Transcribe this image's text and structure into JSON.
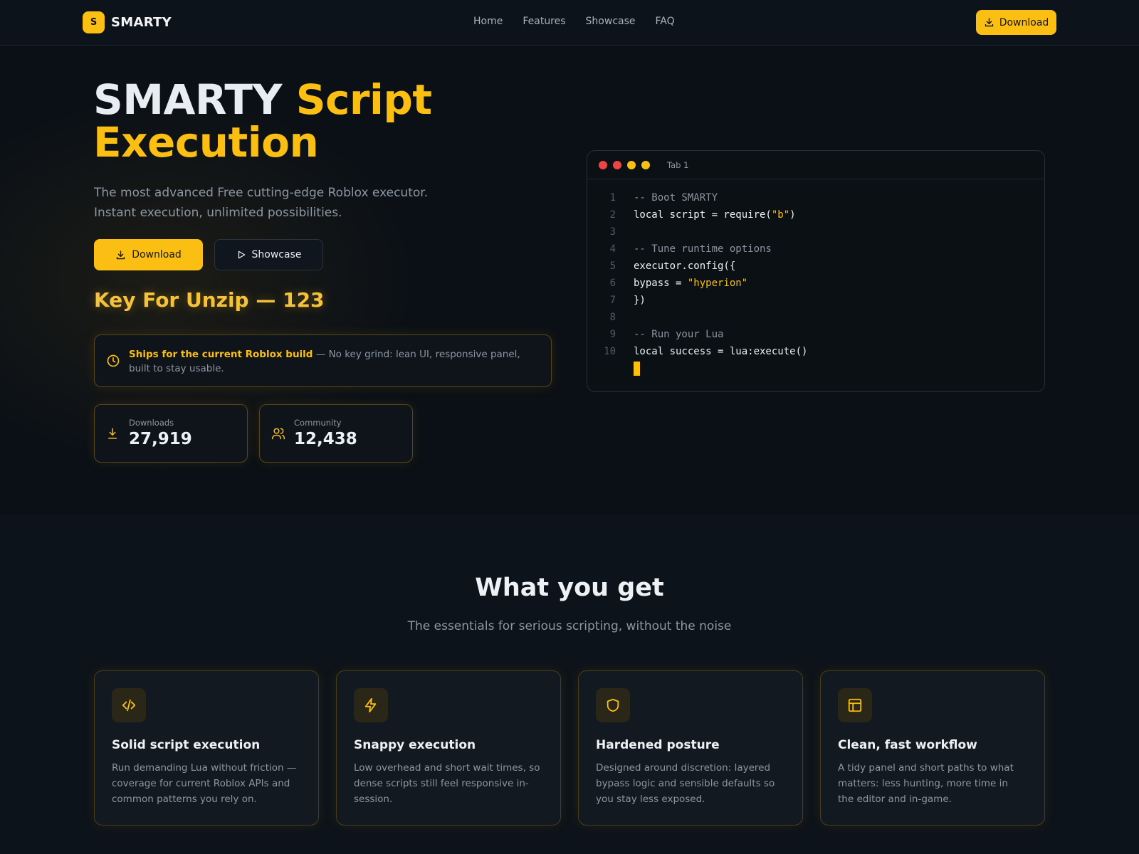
{
  "brand": {
    "logo_letter": "S",
    "name": "SMARTY"
  },
  "nav": {
    "links": [
      "Home",
      "Features",
      "Showcase",
      "FAQ"
    ],
    "download_label": "Download"
  },
  "hero": {
    "title_white": "SMARTY ",
    "title_yellow_1": "Script",
    "title_yellow_2": "Execution",
    "subtitle": "The most advanced Free cutting-edge Roblox executor. Instant execution, unlimited possibilities.",
    "download_label": "Download",
    "showcase_label": "Showcase",
    "key_text": "Key For Unzip — 123",
    "notice_bold": "Ships for the current Roblox build",
    "notice_rest": " — No key grind: lean UI, responsive panel, built to stay usable.",
    "stats": [
      {
        "label": "Downloads",
        "value": "27,919"
      },
      {
        "label": "Community",
        "value": "12,438"
      }
    ]
  },
  "code_window": {
    "tab_label": "Tab 1",
    "lines": [
      {
        "n": "1",
        "text": "-- Boot SMARTY",
        "comment": true
      },
      {
        "n": "2",
        "pre": "local script = require(",
        "str": "\"b\"",
        "post": ")"
      },
      {
        "n": "3",
        "text": ""
      },
      {
        "n": "4",
        "text": "-- Tune runtime options",
        "comment": true
      },
      {
        "n": "5",
        "text": "executor.config({"
      },
      {
        "n": "6",
        "pre": "bypass = ",
        "str": "\"hyperion\"",
        "post": ""
      },
      {
        "n": "7",
        "text": "})"
      },
      {
        "n": "8",
        "text": ""
      },
      {
        "n": "9",
        "text": "-- Run your Lua",
        "comment": true
      },
      {
        "n": "10",
        "text": "local success = lua:execute()"
      }
    ]
  },
  "features": {
    "title": "What you get",
    "subtitle": "The essentials for serious scripting, without the noise",
    "cards": [
      {
        "icon": "code-icon",
        "title": "Solid script execution",
        "text": "Run demanding Lua without friction — coverage for current Roblox APIs and common patterns you rely on."
      },
      {
        "icon": "lightning-icon",
        "title": "Snappy execution",
        "text": "Low overhead and short wait times, so dense scripts still feel responsive in-session."
      },
      {
        "icon": "shield-icon",
        "title": "Hardened posture",
        "text": "Designed around discretion: layered bypass logic and sensible defaults so you stay less exposed."
      },
      {
        "icon": "layout-icon",
        "title": "Clean, fast workflow",
        "text": "A tidy panel and short paths to what matters: less hunting, more time in the editor and in-game."
      }
    ]
  },
  "colors": {
    "accent": "#fbbf13",
    "background": "#0d131a",
    "dot_red": "#ef4444",
    "dot_yellow": "#fbbf13"
  }
}
